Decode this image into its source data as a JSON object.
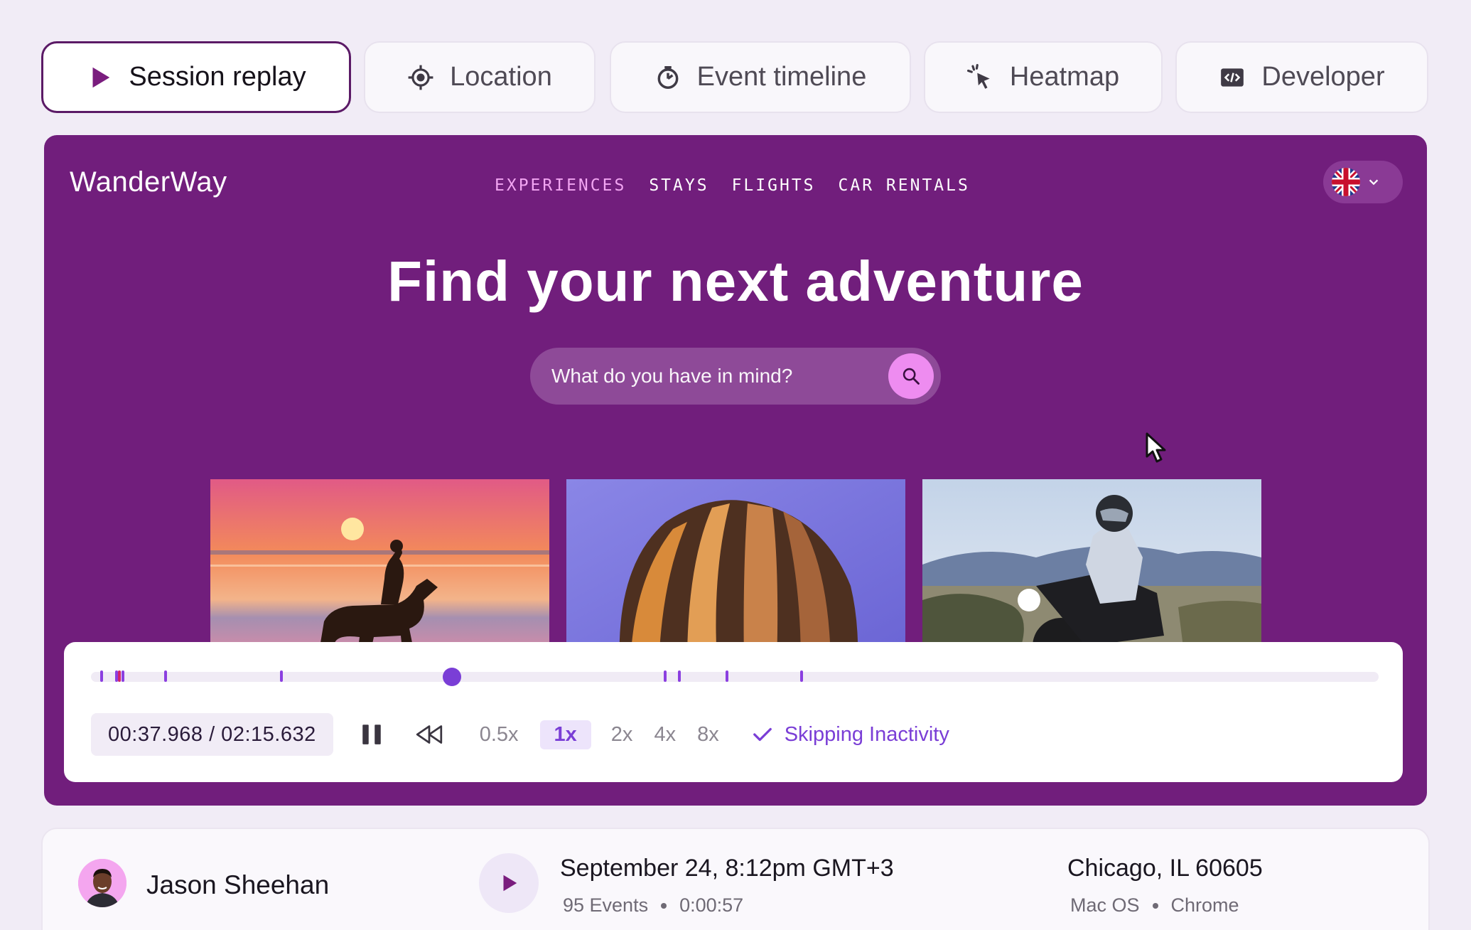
{
  "tabs": [
    {
      "label": "Session replay",
      "icon": "play-icon",
      "active": true
    },
    {
      "label": "Location",
      "icon": "crosshair-icon",
      "active": false
    },
    {
      "label": "Event timeline",
      "icon": "timer-icon",
      "active": false
    },
    {
      "label": "Heatmap",
      "icon": "click-pointer-icon",
      "active": false
    },
    {
      "label": "Developer",
      "icon": "code-icon",
      "active": false
    }
  ],
  "site": {
    "logo": "WanderWay",
    "nav": [
      "EXPERIENCES",
      "STAYS",
      "FLIGHTS",
      "CAR RENTALS"
    ],
    "active_nav": "EXPERIENCES",
    "language_icon": "uk-flag-icon",
    "headline": "Find your next adventure",
    "search_placeholder": "What do you have in mind?",
    "photos": [
      "horse-rider-sunset-beach",
      "hot-air-balloon",
      "motorcycle-rider-desert"
    ],
    "colors": {
      "background": "#711e7c",
      "accent": "#ee8cf0"
    }
  },
  "player": {
    "time": "00:37.968 / 02:15.632",
    "progress": 0.2802,
    "event_markers": [
      0.007,
      0.019,
      0.024,
      0.057,
      0.147,
      0.445,
      0.456,
      0.493,
      0.551
    ],
    "error_markers": [
      0.021
    ],
    "speeds": [
      "0.5x",
      "1x",
      "2x",
      "4x",
      "8x"
    ],
    "selected_speed": "1x",
    "skip_label": "Skipping Inactivity",
    "accent": "#7a3ed6"
  },
  "session": {
    "user": "Jason Sheehan",
    "date": "September 24, 8:12pm GMT+3",
    "events": "95 Events",
    "duration": "0:00:57",
    "location": "Chicago, IL 60605",
    "os": "Mac OS",
    "browser": "Chrome"
  }
}
